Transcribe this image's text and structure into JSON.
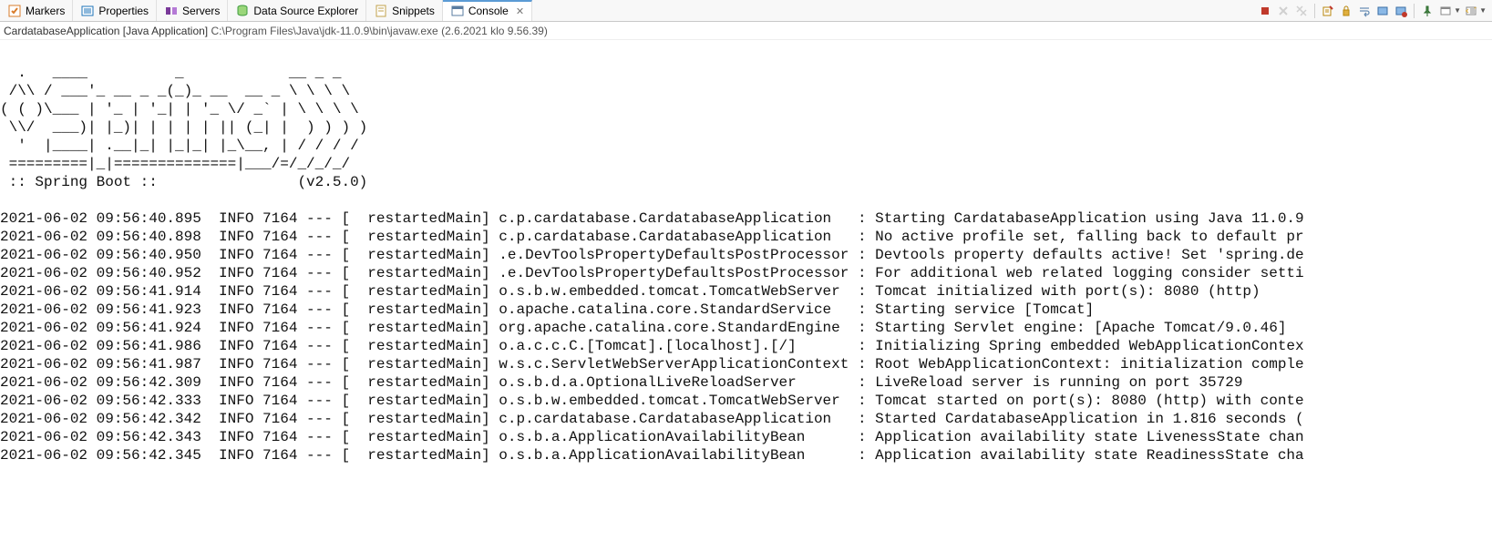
{
  "tabs": {
    "markers": {
      "label": "Markers",
      "icon_color": "#d97c2b"
    },
    "properties": {
      "label": "Properties",
      "icon_color": "#1e73b8"
    },
    "servers": {
      "label": "Servers",
      "icon_color": "#7a3a9a"
    },
    "dse": {
      "label": "Data Source Explorer",
      "icon_color": "#3f9b3f"
    },
    "snippets": {
      "label": "Snippets",
      "icon_color": "#c2a24d"
    },
    "console": {
      "label": "Console",
      "icon_color": "#5a7ca0"
    }
  },
  "sub": {
    "app": "CardatabaseApplication [Java Application]",
    "path": "C:\\Program Files\\Java\\jdk-11.0.9\\bin\\javaw.exe",
    "time": "(2.6.2021 klo 9.56.39)"
  },
  "banner": [
    "  .   ____          _            __ _ _",
    " /\\\\ / ___'_ __ _ _(_)_ __  __ _ \\ \\ \\ \\",
    "( ( )\\___ | '_ | '_| | '_ \\/ _` | \\ \\ \\ \\",
    " \\\\/  ___)| |_)| | | | | || (_| |  ) ) ) )",
    "  '  |____| .__|_| |_|_| |_\\__, | / / / /",
    " =========|_|==============|___/=/_/_/_/",
    " :: Spring Boot ::                (v2.5.0)",
    ""
  ],
  "log_lines": [
    "2021-06-02 09:56:40.895  INFO 7164 --- [  restartedMain] c.p.cardatabase.CardatabaseApplication   : Starting CardatabaseApplication using Java 11.0.9",
    "2021-06-02 09:56:40.898  INFO 7164 --- [  restartedMain] c.p.cardatabase.CardatabaseApplication   : No active profile set, falling back to default pr",
    "2021-06-02 09:56:40.950  INFO 7164 --- [  restartedMain] .e.DevToolsPropertyDefaultsPostProcessor : Devtools property defaults active! Set 'spring.de",
    "2021-06-02 09:56:40.952  INFO 7164 --- [  restartedMain] .e.DevToolsPropertyDefaultsPostProcessor : For additional web related logging consider setti",
    "2021-06-02 09:56:41.914  INFO 7164 --- [  restartedMain] o.s.b.w.embedded.tomcat.TomcatWebServer  : Tomcat initialized with port(s): 8080 (http)",
    "2021-06-02 09:56:41.923  INFO 7164 --- [  restartedMain] o.apache.catalina.core.StandardService   : Starting service [Tomcat]",
    "2021-06-02 09:56:41.924  INFO 7164 --- [  restartedMain] org.apache.catalina.core.StandardEngine  : Starting Servlet engine: [Apache Tomcat/9.0.46]",
    "2021-06-02 09:56:41.986  INFO 7164 --- [  restartedMain] o.a.c.c.C.[Tomcat].[localhost].[/]       : Initializing Spring embedded WebApplicationContex",
    "2021-06-02 09:56:41.987  INFO 7164 --- [  restartedMain] w.s.c.ServletWebServerApplicationContext : Root WebApplicationContext: initialization comple",
    "2021-06-02 09:56:42.309  INFO 7164 --- [  restartedMain] o.s.b.d.a.OptionalLiveReloadServer       : LiveReload server is running on port 35729",
    "2021-06-02 09:56:42.333  INFO 7164 --- [  restartedMain] o.s.b.w.embedded.tomcat.TomcatWebServer  : Tomcat started on port(s): 8080 (http) with conte",
    "2021-06-02 09:56:42.342  INFO 7164 --- [  restartedMain] c.p.cardatabase.CardatabaseApplication   : Started CardatabaseApplication in 1.816 seconds (",
    "2021-06-02 09:56:42.343  INFO 7164 --- [  restartedMain] o.s.b.a.ApplicationAvailabilityBean      : Application availability state LivenessState chan",
    "2021-06-02 09:56:42.345  INFO 7164 --- [  restartedMain] o.s.b.a.ApplicationAvailabilityBean      : Application availability state ReadinessState cha"
  ]
}
